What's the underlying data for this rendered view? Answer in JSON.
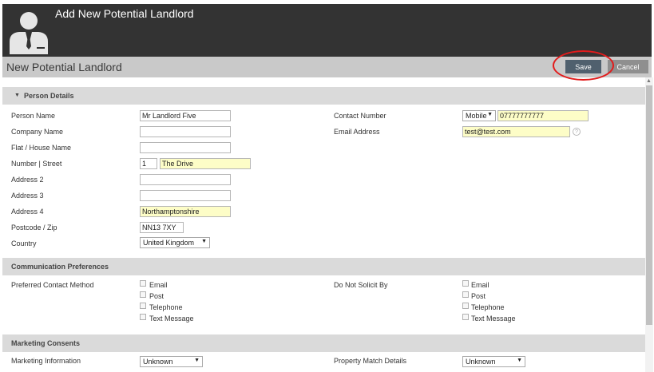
{
  "header": {
    "title": "Add New Potential Landlord"
  },
  "titlebar": {
    "title": "New Potential Landlord",
    "save_label": "Save",
    "cancel_label": "Cancel"
  },
  "sections": {
    "person_details": "Person Details",
    "communication": "Communication Preferences",
    "marketing": "Marketing Consents"
  },
  "person": {
    "person_name_label": "Person Name",
    "person_name_value": "Mr Landlord Five",
    "company_name_label": "Company Name",
    "company_name_value": "",
    "flat_label": "Flat / House Name",
    "flat_value": "",
    "number_street_label": "Number | Street",
    "number_value": "1",
    "street_value": "The Drive",
    "address2_label": "Address 2",
    "address2_value": "",
    "address3_label": "Address 3",
    "address3_value": "",
    "address4_label": "Address 4",
    "address4_value": "Northamptonshire",
    "postcode_label": "Postcode / Zip",
    "postcode_value": "NN13 7XY",
    "country_label": "Country",
    "country_value": "United Kingdom",
    "contact_number_label": "Contact Number",
    "contact_type_value": "Mobile",
    "contact_number_value": "07777777777",
    "email_label": "Email Address",
    "email_value": "test@test.com",
    "help_glyph": "?"
  },
  "communication": {
    "preferred_label": "Preferred Contact Method",
    "preferred_options": [
      "Email",
      "Post",
      "Telephone",
      "Text Message"
    ],
    "do_not_solicit_label": "Do Not Solicit By",
    "do_not_solicit_options": [
      "Email",
      "Post",
      "Telephone",
      "Text Message"
    ]
  },
  "marketing": {
    "marketing_info_label": "Marketing Information",
    "marketing_info_value": "Unknown",
    "property_match_label": "Property Match Details",
    "property_match_value": "Unknown"
  },
  "icons": {
    "avatar": "person-silhouette-icon",
    "dropdown": "triangle-down-icon",
    "collapse": "caret-down-icon"
  },
  "colors": {
    "topbar": "#333333",
    "titlebar": "#c9c9c9",
    "save": "#50606e",
    "cancel": "#8f8f8f",
    "highlight_ring": "#e21b1b",
    "field_highlight": "#fdfdc7"
  }
}
